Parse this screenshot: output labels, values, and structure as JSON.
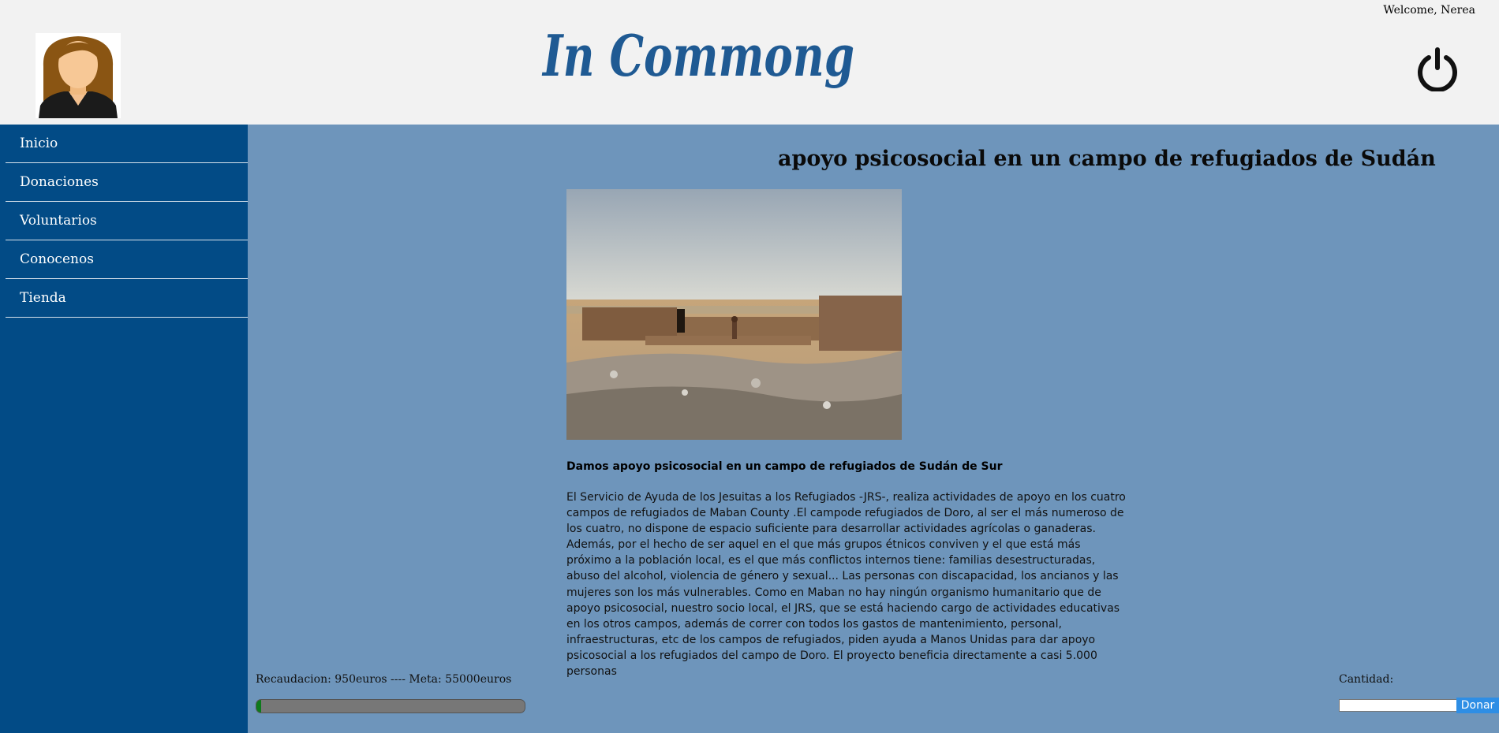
{
  "header": {
    "logo_text": "In Commong",
    "welcome": "Welcome, Nerea",
    "avatar_icon": "user-avatar-female",
    "power_icon": "power-icon"
  },
  "sidebar": {
    "items": [
      {
        "label": "Inicio"
      },
      {
        "label": "Donaciones"
      },
      {
        "label": "Voluntarios"
      },
      {
        "label": "Conocenos"
      },
      {
        "label": "Tienda"
      }
    ]
  },
  "project": {
    "title": "apoyo psicosocial en un campo de refugiados de Sudán",
    "subtitle": "Damos apoyo psicosocial en un campo de refugiados de Sudán de Sur",
    "description": "El Servicio de Ayuda de los Jesuitas a los Refugiados -JRS-, realiza actividades de apoyo en los cuatro campos de refugiados de Maban County .El campode refugiados de Doro, al ser el más numeroso de los cuatro, no dispone de espacio suficiente para desarrollar actividades agrícolas o ganaderas. Además, por el hecho de ser aquel en el que más grupos étnicos conviven y el que está más próximo a la población local, es el que más conflictos internos tiene: familias desestructuradas, abuso del alcohol, violencia de género y sexual... Las personas con discapacidad, los ancianos y las mujeres son los más vulnerables. Como en Maban no hay ningún organismo humanitario que de apoyo psicosocial, nuestro socio local, el JRS, que se está haciendo cargo de actividades educativas en los otros campos, además de correr con todos los gastos de mantenimiento, personal, infraestructuras, etc de los campos de refugiados, piden ayuda a Manos Unidas para dar apoyo psicosocial a los refugiados del campo de Doro. El proyecto beneficia directamente a casi 5.000 personas"
  },
  "funding": {
    "status_text": "Recaudacion: 950euros ---- Meta: 55000euros",
    "raised": 950,
    "goal": 55000,
    "progress_color": "#0d7a1b"
  },
  "donate": {
    "quantity_label": "Cantidad:",
    "quantity_value": "",
    "button_label": "Donar"
  },
  "colors": {
    "sidebar": "#024b86",
    "content_bg": "#6e95bb",
    "header_bg": "#f2f2f2",
    "logo": "#1f5a93",
    "button": "#2e8ee5"
  }
}
